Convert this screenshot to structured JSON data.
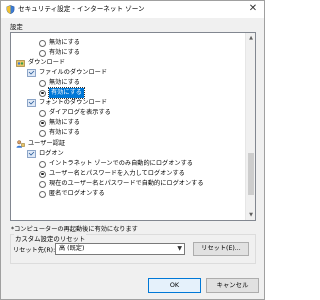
{
  "window": {
    "title": "セキュリティ設定 - インターネット ゾーン",
    "close_glyph": "✕"
  },
  "settings": {
    "group_label": "設定",
    "rows": [
      {
        "label": "無効にする",
        "kind": "radio",
        "checked": false
      },
      {
        "label": "有効にする",
        "kind": "radio",
        "checked": false
      },
      {
        "label": "ダウンロード",
        "kind": "category",
        "icon": "settings-category-icon"
      },
      {
        "label": "ファイルのダウンロード",
        "kind": "setting",
        "icon": "setting-node-icon"
      },
      {
        "label": "無効にする",
        "kind": "radio",
        "checked": false
      },
      {
        "label": "有効にする",
        "kind": "radio",
        "checked": true,
        "selected": true
      },
      {
        "label": "フォントのダウンロード",
        "kind": "setting",
        "icon": "setting-node-icon"
      },
      {
        "label": "ダイアログを表示する",
        "kind": "radio",
        "checked": false
      },
      {
        "label": "無効にする",
        "kind": "radio",
        "checked": true
      },
      {
        "label": "有効にする",
        "kind": "radio",
        "checked": false
      },
      {
        "label": "ユーザー認証",
        "kind": "category",
        "icon": "user-auth-icon"
      },
      {
        "label": "ログオン",
        "kind": "setting",
        "icon": "setting-node-icon"
      },
      {
        "label": "イントラネット ゾーンでのみ自動的にログオンする",
        "kind": "radio",
        "checked": false
      },
      {
        "label": "ユーザー名とパスワードを入力してログオンする",
        "kind": "radio",
        "checked": true
      },
      {
        "label": "現在のユーザー名とパスワードで自動的にログオンする",
        "kind": "radio",
        "checked": false
      },
      {
        "label": "匿名でログオンする",
        "kind": "radio",
        "checked": false
      }
    ],
    "footnote": "*コンピューターの再起動後に有効になります"
  },
  "reset": {
    "group_title": "カスタム設定のリセット",
    "label": "リセット先(R):",
    "selected_value": "高 (既定)",
    "button_label": "リセット(E)..."
  },
  "buttons": {
    "ok": "OK",
    "cancel": "キャンセル"
  },
  "colors": {
    "selection": "#0078d7",
    "window_bg": "#f0f0f0"
  }
}
